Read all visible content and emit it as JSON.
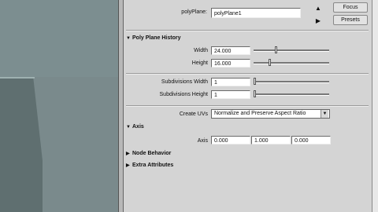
{
  "header": {
    "node_label": "polyPlane:",
    "node_value": "polyPlane1",
    "focus_label": "Focus",
    "presets_label": "Presets"
  },
  "sections": {
    "history_title": "Poly Plane History",
    "axis_title": "Axis",
    "node_behavior_title": "Node Behavior",
    "extra_attributes_title": "Extra Attributes"
  },
  "history": {
    "width_label": "Width",
    "width_value": "24.000",
    "height_label": "Height",
    "height_value": "16.000",
    "subdiv_width_label": "Subdivisions Width",
    "subdiv_width_value": "1",
    "subdiv_height_label": "Subdivisions Height",
    "subdiv_height_value": "1",
    "create_uvs_label": "Create UVs",
    "create_uvs_value": "Normalize and Preserve Aspect Ratio"
  },
  "axis": {
    "label": "Axis",
    "x": "0.000",
    "y": "1.000",
    "z": "0.000"
  }
}
